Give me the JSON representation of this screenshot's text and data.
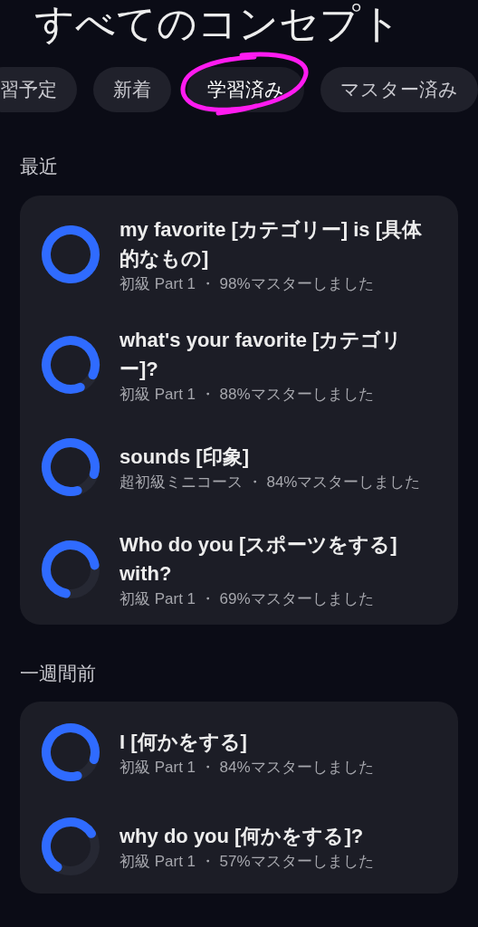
{
  "title": "すべてのコンセプト",
  "tabs": [
    {
      "label": "習予定",
      "selected": false
    },
    {
      "label": "新着",
      "selected": false
    },
    {
      "label": "学習済み",
      "selected": true
    },
    {
      "label": "マスター済み",
      "selected": false
    }
  ],
  "sections": [
    {
      "heading": "最近",
      "items": [
        {
          "title": "my favorite [カテゴリー] is [具体的なもの]",
          "subtitle": "初級 Part 1 ・ 98%マスターしました",
          "level": 0.98
        },
        {
          "title": "what's your favorite [カテゴリー]?",
          "subtitle": "初級 Part 1 ・ 88%マスターしました",
          "level": 0.88
        },
        {
          "title": "sounds [印象]",
          "subtitle": "超初級ミニコース ・ 84%マスターしました",
          "level": 0.84
        },
        {
          "title": "Who do you [スポーツをする] with?",
          "subtitle": "初級 Part 1 ・ 69%マスターしました",
          "level": 0.69
        }
      ]
    },
    {
      "heading": "一週間前",
      "items": [
        {
          "title": "I [何かをする]",
          "subtitle": "初級 Part 1 ・ 84%マスターしました",
          "level": 0.84
        },
        {
          "title": "why do you [何かをする]?",
          "subtitle": "初級 Part 1 ・ 57%マスターしました",
          "level": 0.57
        }
      ]
    }
  ]
}
